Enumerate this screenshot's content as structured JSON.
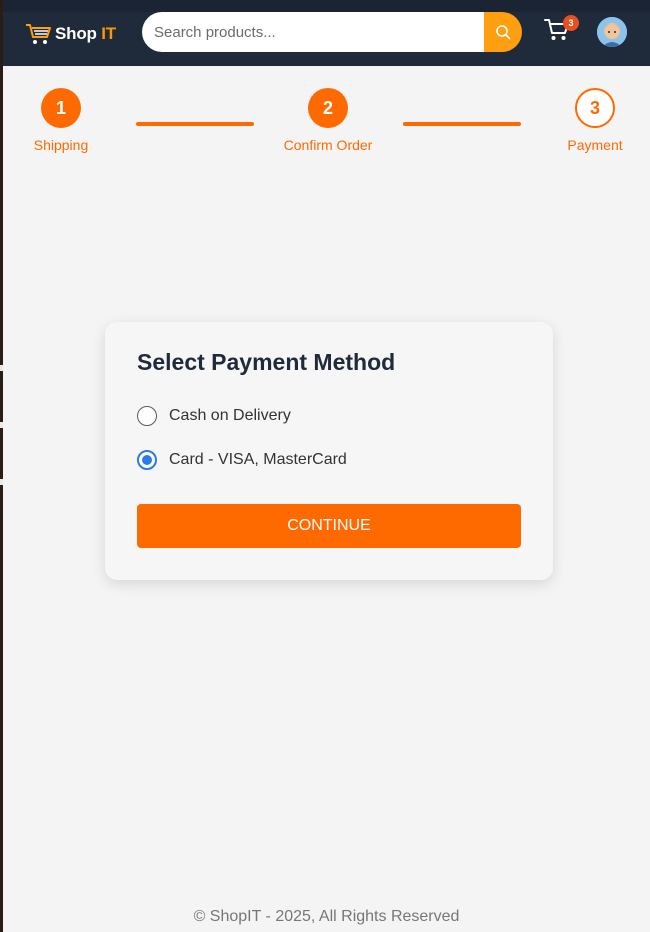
{
  "header": {
    "logo_text_main": "Shop",
    "logo_text_accent": "IT",
    "search_placeholder": "Search products...",
    "cart_count": "3"
  },
  "steps": [
    {
      "number": "1",
      "label": "Shipping"
    },
    {
      "number": "2",
      "label": "Confirm Order"
    },
    {
      "number": "3",
      "label": "Payment"
    }
  ],
  "payment": {
    "title": "Select Payment Method",
    "options": [
      {
        "label": "Cash on Delivery",
        "selected": false
      },
      {
        "label": "Card - VISA, MasterCard",
        "selected": true
      }
    ],
    "continue_label": "CONTINUE"
  },
  "footer": {
    "text": "© ShopIT - 2025, All Rights Reserved"
  },
  "colors": {
    "header_bg": "#1f2a3a",
    "accent": "#ff6a00",
    "search_button": "#ff9f10",
    "radio_selected": "#2c7be5"
  }
}
